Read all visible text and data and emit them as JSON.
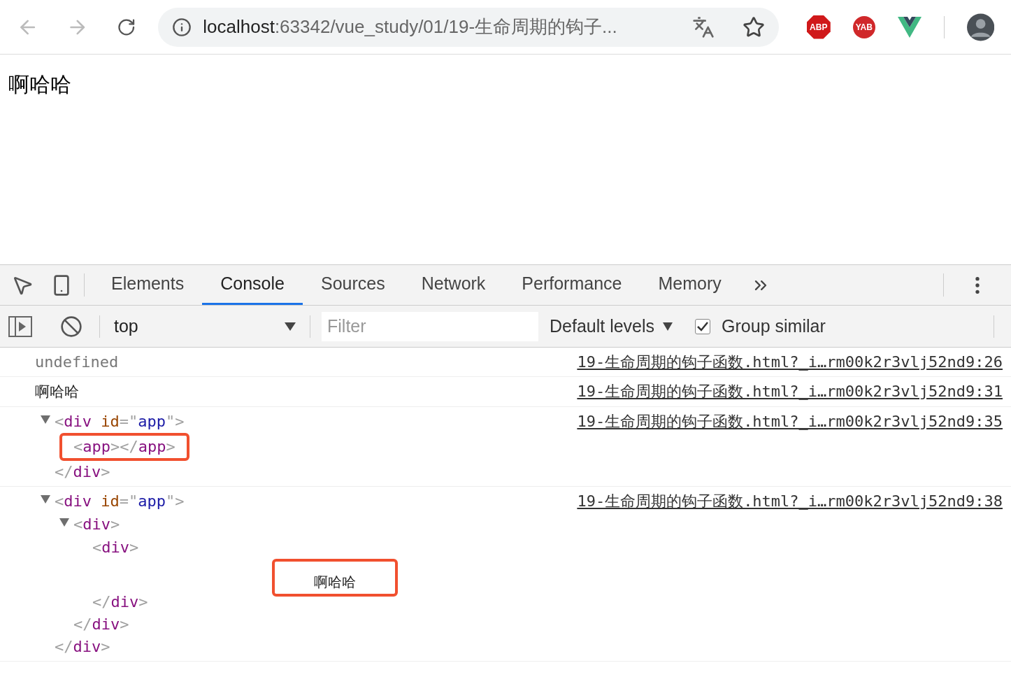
{
  "browser": {
    "url_host": "localhost",
    "url_rest": ":63342/vue_study/01/19-生命周期的钩子...",
    "extensions": [
      {
        "kind": "abp",
        "label": "ABP"
      },
      {
        "kind": "yab",
        "label": "YAB"
      },
      {
        "kind": "vue"
      }
    ]
  },
  "page": {
    "text": "啊哈哈"
  },
  "devtools": {
    "tabs": [
      {
        "label": "Elements",
        "selected": false
      },
      {
        "label": "Console",
        "selected": true
      },
      {
        "label": "Sources",
        "selected": false
      },
      {
        "label": "Network",
        "selected": false
      },
      {
        "label": "Performance",
        "selected": false
      },
      {
        "label": "Memory",
        "selected": false
      }
    ],
    "context": "top",
    "filter": {
      "placeholder": "Filter"
    },
    "levels": "Default levels",
    "group_similar": {
      "label": "Group similar",
      "checked": true
    }
  },
  "messages": [
    {
      "kind": "text",
      "muted": true,
      "text": "undefined",
      "source": "19-生命周期的钩子函数.html?_i…rm00k2r3vlj52nd9:26"
    },
    {
      "kind": "text",
      "muted": false,
      "text": "啊哈哈",
      "source": "19-生命周期的钩子函数.html?_i…rm00k2r3vlj52nd9:31"
    },
    {
      "kind": "element",
      "source": "19-生命周期的钩子函数.html?_i…rm00k2r3vlj52nd9:35",
      "node": {
        "open": "<div id=\"app\">",
        "close": "</div>",
        "expanded": true,
        "highlighted": false,
        "children": [
          {
            "open": "<app></app>",
            "highlighted": true
          }
        ]
      }
    },
    {
      "kind": "element",
      "source": "19-生命周期的钩子函数.html?_i…rm00k2r3vlj52nd9:38",
      "node": {
        "open": "<div id=\"app\">",
        "close": "</div>",
        "expanded": true,
        "highlighted": false,
        "children": [
          {
            "open": "<div>",
            "close": "</div>",
            "expanded": true,
            "highlighted": false,
            "children": [
              {
                "open": "<div>",
                "close": "</div>",
                "highlighted": false,
                "children": [
                  {
                    "text": "啊哈哈",
                    "highlighted": true
                  }
                ]
              }
            ]
          }
        ]
      }
    }
  ]
}
